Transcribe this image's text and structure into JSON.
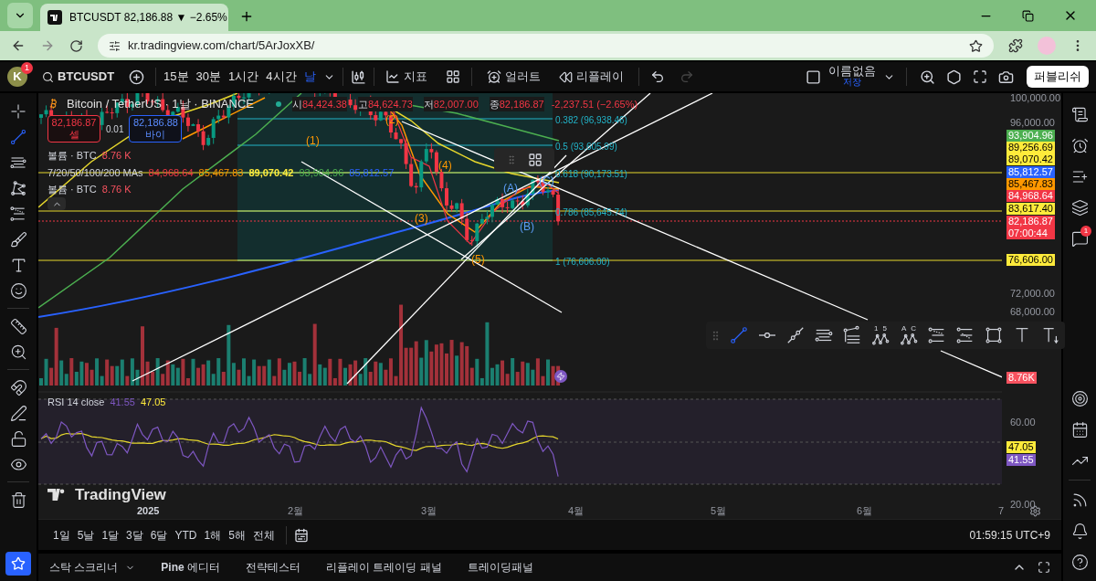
{
  "browser": {
    "tab": {
      "title": "BTCUSDT 82,186.88 ▼ −2.65%"
    },
    "url": "kr.tradingview.com/chart/5ArJoxXB/"
  },
  "toolbar": {
    "avatar": {
      "letter": "K",
      "badge": "1"
    },
    "symbol": "BTCUSDT",
    "intervals": [
      {
        "label": "15분",
        "selected": false
      },
      {
        "label": "30분",
        "selected": false
      },
      {
        "label": "1시간",
        "selected": false
      },
      {
        "label": "4시간",
        "selected": false
      },
      {
        "label": "날",
        "selected": true
      }
    ],
    "indicators": "지표",
    "alerts": "얼러트",
    "replay": "리플레이",
    "layout": {
      "name": "이름없음",
      "status": "저장"
    },
    "publish": "퍼블리쉬"
  },
  "left_tools": [
    {
      "kind": "crosshair",
      "selected": false
    },
    {
      "kind": "trend",
      "selected": true
    },
    {
      "kind": "lines",
      "selected": false
    },
    {
      "kind": "pattern",
      "selected": false
    },
    {
      "kind": "fib",
      "selected": false
    },
    {
      "kind": "brush",
      "selected": false
    },
    {
      "kind": "text",
      "selected": false
    },
    {
      "kind": "emoji",
      "selected": false
    },
    {
      "kind": "ruler",
      "selected": false
    },
    {
      "kind": "zoom",
      "selected": false
    },
    {
      "kind": "magnet",
      "selected": false
    },
    {
      "kind": "pencil-lock",
      "selected": false
    },
    {
      "kind": "lock",
      "selected": false
    },
    {
      "kind": "eye",
      "selected": false
    },
    {
      "kind": "trash",
      "selected": false
    }
  ],
  "chart": {
    "legend": {
      "title": "Bitcoin / TetherUS · 1날 · BINANCE",
      "ohlc": [
        {
          "label": "시",
          "value": "84,424.38"
        },
        {
          "label": "고",
          "value": "84,624.73"
        },
        {
          "label": "저",
          "value": "82,007.00"
        },
        {
          "label": "종",
          "value": "82,186.87"
        }
      ],
      "change": "-2,237.51 (−2.65%)"
    },
    "trade": {
      "sell": {
        "price": "82,186.87",
        "label": "셀"
      },
      "spread": "0.01",
      "buy": {
        "price": "82,186.88",
        "label": "바이"
      }
    },
    "indicators": [
      {
        "name": "볼륨 · BTC",
        "values": [
          {
            "text": "8.76 K",
            "color": "#f7525f"
          }
        ]
      },
      {
        "name": "7/20/50/100/200 MAs",
        "values": [
          {
            "text": "84,968.64",
            "color": "#f23645"
          },
          {
            "text": "85,467.83",
            "color": "#ff9800"
          },
          {
            "text": "89,070.42",
            "color": "#ffeb3b"
          },
          {
            "text": "93,904.96",
            "color": "#4caf50"
          },
          {
            "text": "85,812.57",
            "color": "#2962ff"
          }
        ]
      },
      {
        "name": "볼륨 · BTC",
        "values": [
          {
            "text": "8.76 K",
            "color": "#f7525f"
          }
        ]
      }
    ],
    "fib_levels": [
      "0.382 (96,938.46)",
      "0.5 (93,605.99)",
      "0.618 (90,173.51)",
      "0.786 (85,645.74)",
      "1 (76,606.00)"
    ],
    "wave_labels": [
      {
        "text": "(1)",
        "kind": "impulse"
      },
      {
        "text": "(2)",
        "kind": "impulse"
      },
      {
        "text": "(3)",
        "kind": "impulse"
      },
      {
        "text": "(4)",
        "kind": "impulse"
      },
      {
        "text": "(5)",
        "kind": "impulse"
      },
      {
        "text": "(A)",
        "kind": "corrective"
      },
      {
        "text": "(B)",
        "kind": "corrective"
      },
      {
        "text": "(C)",
        "kind": "corrective"
      }
    ],
    "rsi": {
      "name": "RSI 14 close",
      "values": [
        {
          "text": "41.55",
          "color": "#7e57c2"
        },
        {
          "text": "47.05",
          "color": "#ffeb3b"
        }
      ]
    },
    "logo": "TradingView"
  },
  "drawing_toolbar": [
    {
      "kind": "trend",
      "selected": true
    },
    {
      "kind": "hray",
      "selected": false
    },
    {
      "kind": "extended",
      "selected": false
    },
    {
      "kind": "channel",
      "selected": false
    },
    {
      "kind": "pitchfork",
      "selected": false
    },
    {
      "kind": "wave",
      "selected": false,
      "labels": [
        "1",
        "5"
      ]
    },
    {
      "kind": "wave",
      "selected": false,
      "labels": [
        "A",
        "C"
      ]
    },
    {
      "kind": "fib",
      "selected": false
    },
    {
      "kind": "fib2",
      "selected": false
    },
    {
      "kind": "rectangle",
      "selected": false
    },
    {
      "kind": "text",
      "selected": false
    },
    {
      "kind": "anchored-text",
      "selected": false
    }
  ],
  "price_axis": [
    {
      "kind": "tick",
      "text": "100,000.00"
    },
    {
      "kind": "tick",
      "text": "96,000.00"
    },
    {
      "kind": "badge",
      "text": "93,904.96",
      "color": "#4caf50"
    },
    {
      "kind": "badge",
      "text": "89,256.69",
      "color": "#ffeb3b"
    },
    {
      "kind": "badge",
      "text": "89,070.42",
      "color": "#ffeb3b"
    },
    {
      "kind": "badge",
      "text": "85,812.57",
      "color": "#2962ff"
    },
    {
      "kind": "badge",
      "text": "85,467.83",
      "color": "#ff9800"
    },
    {
      "kind": "badge",
      "text": "84,968.64",
      "color": "#f23645"
    },
    {
      "kind": "badge",
      "text": "83,617.40",
      "color": "#ffeb3b"
    },
    {
      "kind": "badge",
      "text": "82,186.87",
      "subtext": "07:00:44",
      "color": "#f23645"
    },
    {
      "kind": "badge",
      "text": "76,606.00",
      "color": "#ffeb3b"
    },
    {
      "kind": "tick",
      "text": "72,000.00"
    },
    {
      "kind": "tick",
      "text": "68,000.00"
    },
    {
      "kind": "badge",
      "text": "8.76K",
      "color": "#f7525f"
    },
    {
      "kind": "tick",
      "text": "60.00"
    },
    {
      "kind": "badge",
      "text": "47.05",
      "color": "#ffeb3b"
    },
    {
      "kind": "badge",
      "text": "41.55",
      "color": "#7e57c2"
    },
    {
      "kind": "tick",
      "text": "20.00"
    }
  ],
  "time_axis": [
    "2025",
    "2월",
    "3월",
    "4월",
    "5월",
    "6월",
    "7"
  ],
  "range": {
    "periods": [
      "1일",
      "5날",
      "1달",
      "3달",
      "6달",
      "YTD",
      "1해",
      "5해",
      "전체"
    ],
    "clock": "01:59:15 UTC+9"
  },
  "bottom_tabs": [
    {
      "label": "스탁 스크리너",
      "dropdown": true
    },
    {
      "label": "**Pine** 에디터",
      "dropdown": false
    },
    {
      "label": "전략테스터",
      "dropdown": false
    },
    {
      "label": "리플레이 트레이딩 패널",
      "dropdown": false
    },
    {
      "label": "트레이딩패널",
      "dropdown": false
    }
  ],
  "right_sidebar": [
    {
      "kind": "watchlist"
    },
    {
      "kind": "alerts"
    },
    {
      "kind": "add-list"
    },
    {
      "kind": "layers"
    },
    {
      "kind": "chat",
      "badge": "1"
    },
    {
      "kind": "target"
    },
    {
      "kind": "calendar"
    },
    {
      "kind": "chart"
    },
    {
      "kind": "rss"
    },
    {
      "kind": "bell"
    },
    {
      "kind": "help"
    }
  ]
}
